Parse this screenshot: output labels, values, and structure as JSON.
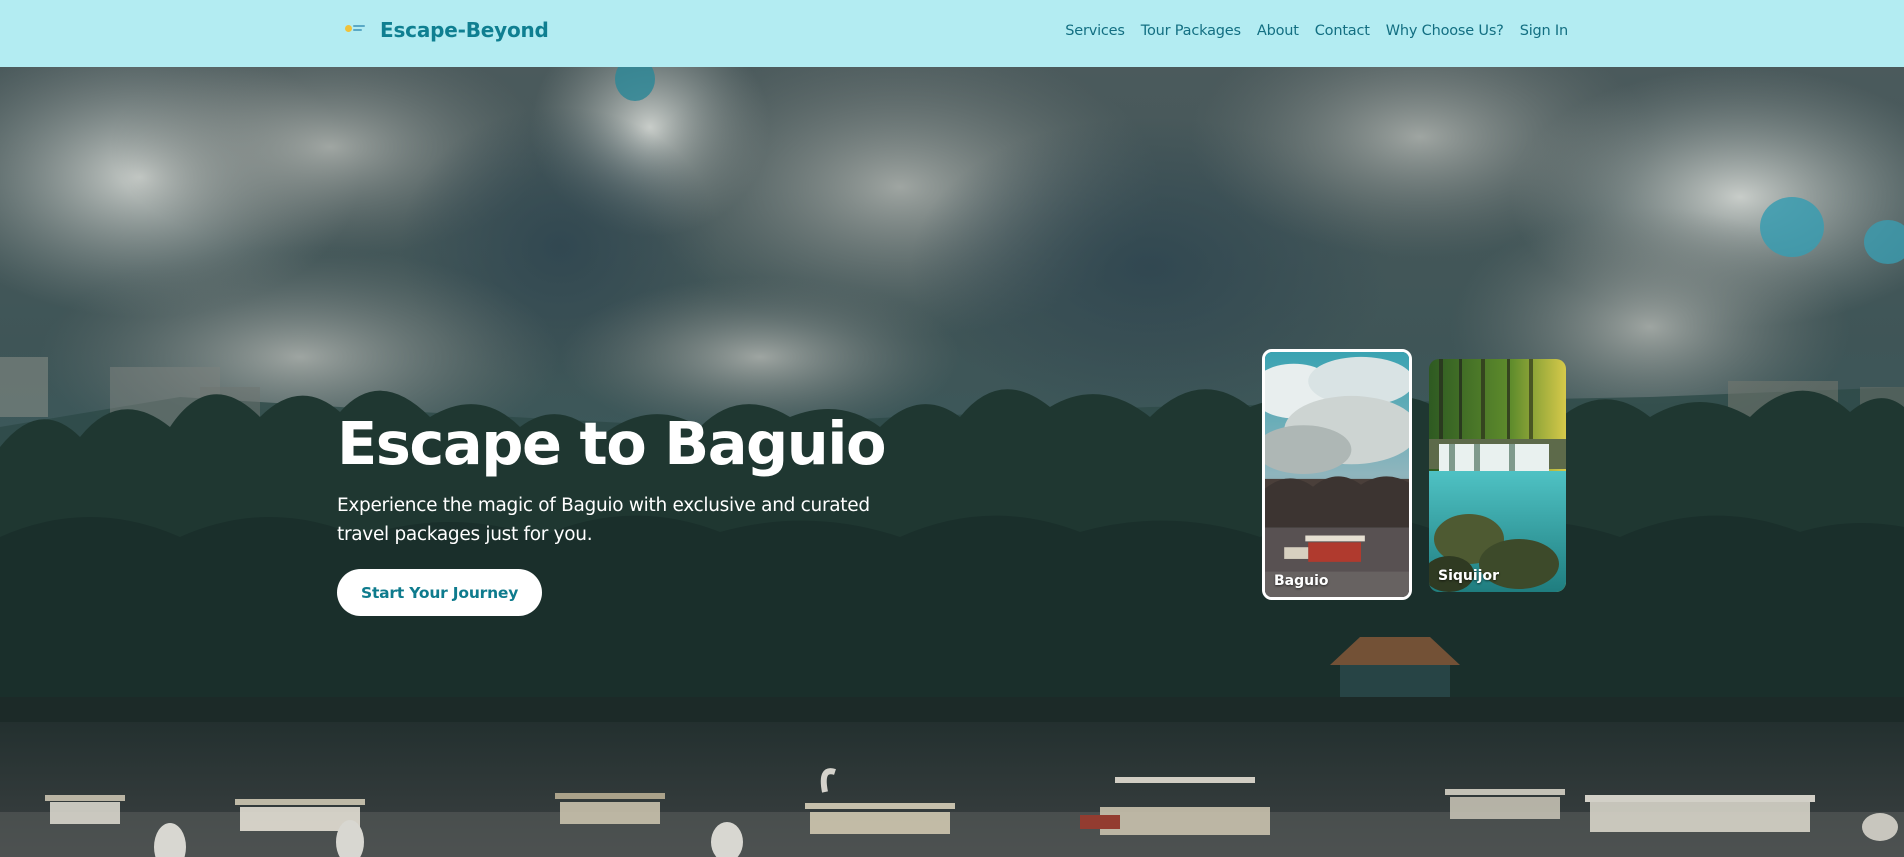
{
  "nav": {
    "brand": "Escape-Beyond",
    "links": [
      "Services",
      "Tour Packages",
      "About",
      "Contact",
      "Why Choose Us?",
      "Sign In"
    ]
  },
  "hero": {
    "title": "Escape to Baguio",
    "subtitle": "Experience the magic of Baguio with exclusive and curated travel packages just for you.",
    "cta": "Start Your Journey"
  },
  "destinations": [
    {
      "name": "Baguio",
      "selected": true
    },
    {
      "name": "Siquijor",
      "selected": false
    }
  ],
  "colors": {
    "navbar_bg": "#b3ecf2",
    "brand": "#0f7f91",
    "nav_link": "#136f82",
    "cta_text": "#0e7b8d"
  }
}
